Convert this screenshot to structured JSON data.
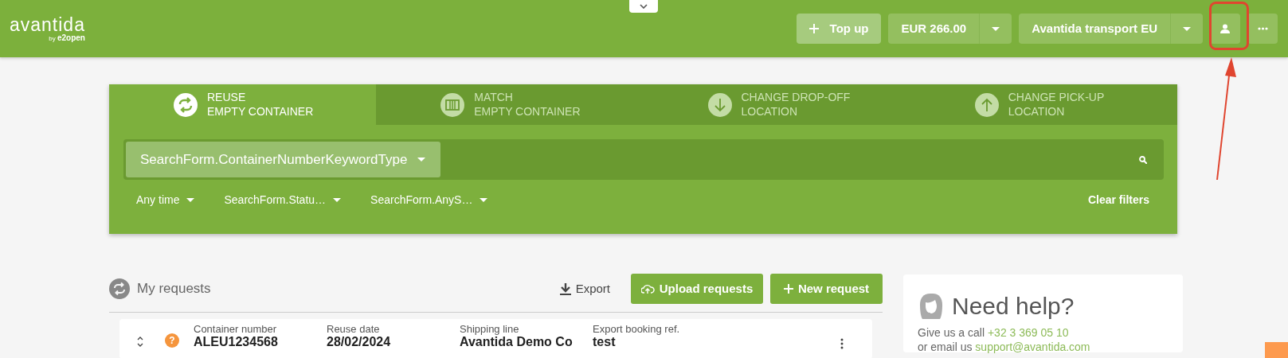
{
  "collapse_toggle": {
    "expanded": true
  },
  "header": {
    "logo": "avantida",
    "logo_by": "by",
    "logo_brand": "e2open",
    "top_up": "Top up",
    "balance": "EUR 266.00",
    "account": "Avantida transport EU"
  },
  "tabs": [
    {
      "kind": "reuse",
      "title": "REUSE",
      "subtitle": "EMPTY CONTAINER",
      "selected": true
    },
    {
      "kind": "match",
      "title": "MATCH",
      "subtitle": "EMPTY CONTAINER",
      "selected": false
    },
    {
      "kind": "dropoff",
      "title": "CHANGE DROP-OFF",
      "subtitle": "LOCATION",
      "selected": false
    },
    {
      "kind": "pickup",
      "title": "CHANGE PICK-UP",
      "subtitle": "LOCATION",
      "selected": false
    }
  ],
  "search": {
    "type_selector": "SearchForm.ContainerNumberKeywordType"
  },
  "filters": [
    {
      "label": "Any time"
    },
    {
      "label": "SearchForm.Statu…"
    },
    {
      "label": "SearchForm.AnyS…"
    }
  ],
  "clear_filters": "Clear filters",
  "requests": {
    "title": "My requests",
    "export": "Export",
    "upload": "Upload requests",
    "new_request": "New request"
  },
  "rows": [
    {
      "status": "?",
      "fields": [
        {
          "label": "Container number",
          "value": "ALEU1234568"
        },
        {
          "label": "Reuse date",
          "value": "28/02/2024"
        },
        {
          "label": "Shipping line",
          "value": "Avantida Demo Co"
        },
        {
          "label": "Export booking ref.",
          "value": "test"
        }
      ]
    }
  ],
  "help": {
    "title": "Need help?",
    "call_text": "Give us a call",
    "phone": "+32 3 369 05 10",
    "email_text": "or email us",
    "email": "support@avantida.com"
  }
}
